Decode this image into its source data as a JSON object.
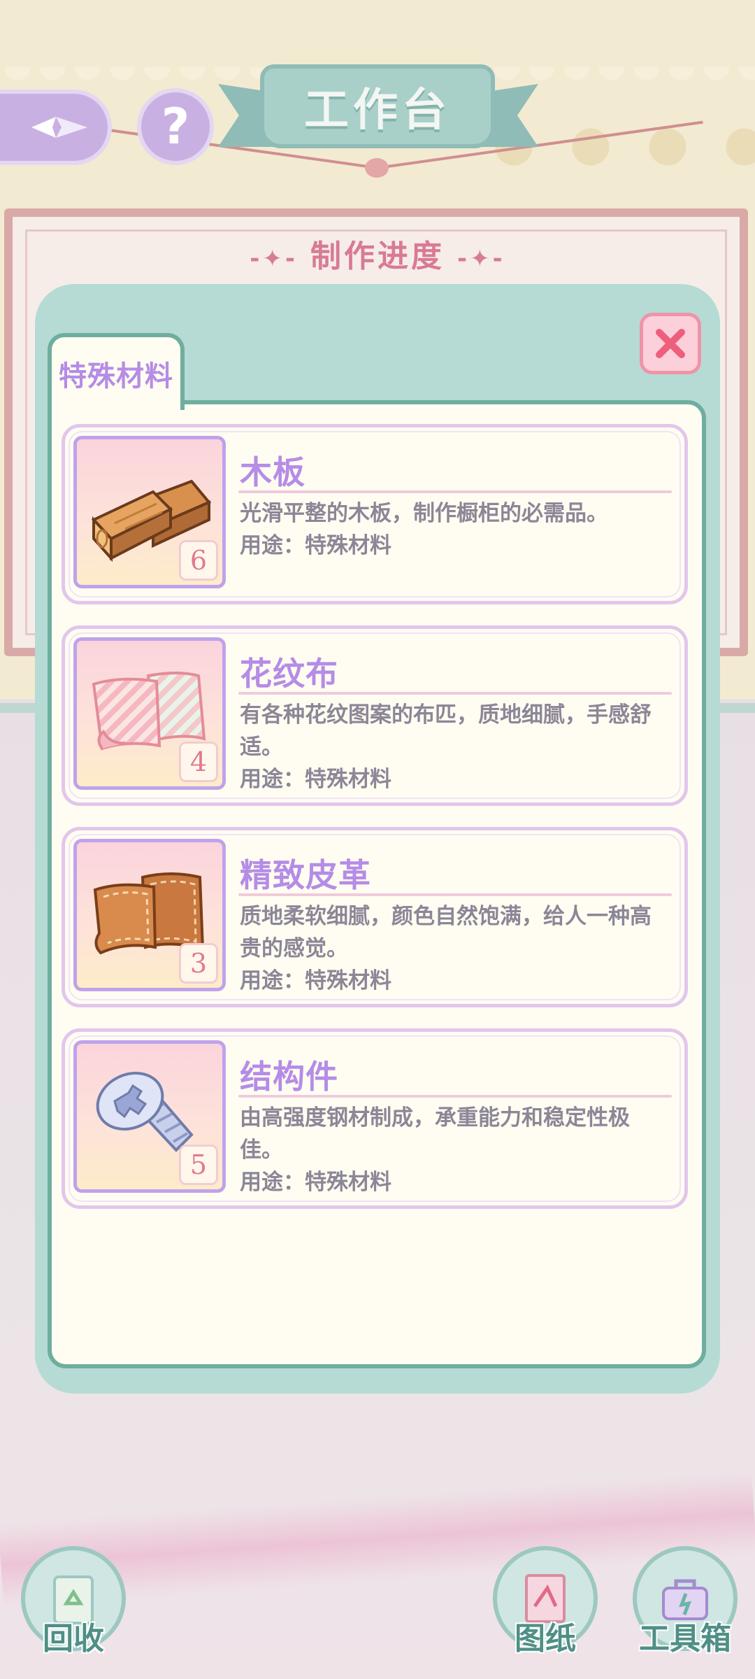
{
  "header": {
    "title": "工作台",
    "help_symbol": "?"
  },
  "progress": {
    "title": "制作进度"
  },
  "modal": {
    "tab_label": "特殊材料",
    "items": [
      {
        "name": "木板",
        "description": "光滑平整的木板，制作橱柜的必需品。",
        "usage": "用途：特殊材料",
        "count": "6",
        "icon": "wood-plank-icon"
      },
      {
        "name": "花纹布",
        "description": "有各种花纹图案的布匹，质地细腻，手感舒适。",
        "usage": "用途：特殊材料",
        "count": "4",
        "icon": "patterned-cloth-icon"
      },
      {
        "name": "精致皮革",
        "description": "质地柔软细腻，颜色自然饱满，给人一种高贵的感觉。",
        "usage": "用途：特殊材料",
        "count": "3",
        "icon": "leather-icon"
      },
      {
        "name": "结构件",
        "description": "由高强度钢材制成，承重能力和稳定性极佳。",
        "usage": "用途：特殊材料",
        "count": "5",
        "icon": "screw-icon"
      }
    ]
  },
  "bottom_bar": {
    "recycle_label": "回收",
    "blueprint_label": "图纸",
    "toolbox_label": "工具箱"
  },
  "colors": {
    "accent_purple": "#b58ce6",
    "panel_teal": "#b5dbd4",
    "count_pink": "#e07a8e",
    "title_pink": "#d97a93"
  }
}
